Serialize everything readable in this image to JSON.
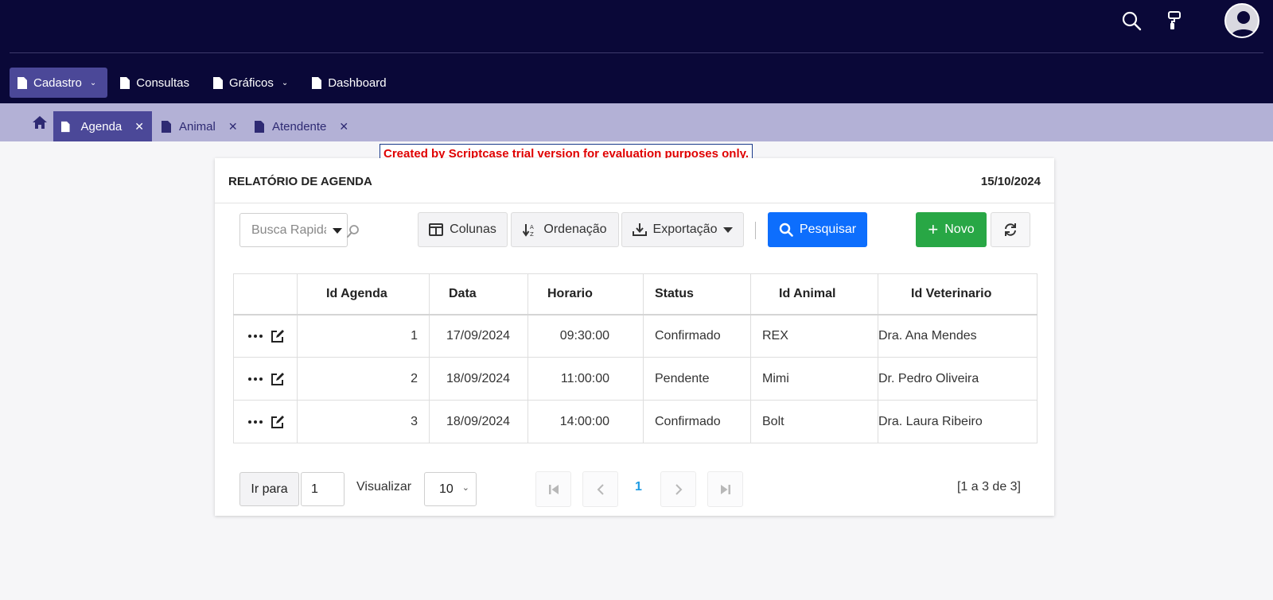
{
  "menu": [
    {
      "label": "Cadastro",
      "has_caret": true,
      "active": true
    },
    {
      "label": "Consultas",
      "has_caret": false,
      "active": false
    },
    {
      "label": "Gráficos",
      "has_caret": true,
      "active": false
    },
    {
      "label": "Dashboard",
      "has_caret": false,
      "active": false
    }
  ],
  "tabs": [
    {
      "label": "Agenda",
      "active": true
    },
    {
      "label": "Animal",
      "active": false
    },
    {
      "label": "Atendente",
      "active": false
    }
  ],
  "trial_notice": "Created by Scriptcase trial version for evaluation purposes only.",
  "report": {
    "title": "RELATÓRIO DE AGENDA",
    "date": "15/10/2024"
  },
  "toolbar": {
    "quick_search_placeholder": "Busca Rapida",
    "columns_label": "Colunas",
    "sort_label": "Ordenação",
    "export_label": "Exportação",
    "search_label": "Pesquisar",
    "new_label": "Novo"
  },
  "table": {
    "headers": [
      "Id Agenda",
      "Data",
      "Horario",
      "Status",
      "Id Animal",
      "Id Veterinario"
    ],
    "rows": [
      [
        "1",
        "17/09/2024",
        "09:30:00",
        "Confirmado",
        "REX",
        "Dra. Ana Mendes"
      ],
      [
        "2",
        "18/09/2024",
        "11:00:00",
        "Pendente",
        "Mimi",
        "Dr. Pedro Oliveira"
      ],
      [
        "3",
        "18/09/2024",
        "14:00:00",
        "Confirmado",
        "Bolt",
        "Dra. Laura Ribeiro"
      ]
    ]
  },
  "pagination": {
    "goto_label": "Ir para",
    "goto_value": "1",
    "view_label": "Visualizar",
    "view_value": "10",
    "current_page": "1",
    "range_text": "[1 a 3 de 3]"
  },
  "colors": {
    "header_bg": "#0a0838",
    "active_menu": "#4b4898",
    "tabbar_bg": "#b3b1d6",
    "primary_blue": "#0d6efd",
    "success_green": "#28a745",
    "trial_red": "#e00000"
  }
}
